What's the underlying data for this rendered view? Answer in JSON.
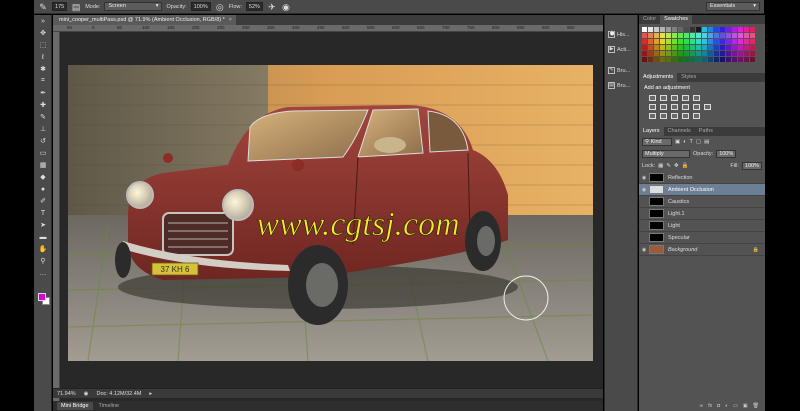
{
  "options_bar": {
    "brush_size": "175",
    "mode_label": "Mode:",
    "mode_value": "Screen",
    "opacity_label": "Opacity:",
    "opacity_value": "100%",
    "flow_label": "Flow:",
    "flow_value": "52%",
    "workspace": "Essentials"
  },
  "document": {
    "tab_title": "mini_cooper_multiPass.psd @ 71.9% (Ambient Occlusion, RGB/8) *",
    "ruler_ticks": [
      "50",
      "0",
      "50",
      "100",
      "150",
      "200",
      "250",
      "300",
      "350",
      "400",
      "450",
      "500",
      "550",
      "600",
      "650",
      "700",
      "750",
      "800",
      "850",
      "900",
      "950"
    ],
    "watermark": "www.cgtsj.com",
    "license_plate": "37 KH 6",
    "zoom": "71.94%",
    "doc_size": "Doc: 4.12M/32.4M"
  },
  "bottom_tabs": [
    "Mini Bridge",
    "Timeline"
  ],
  "mid_panel": [
    "His...",
    "Acti...",
    "Bru...",
    "Bru..."
  ],
  "panels": {
    "color_tabs": [
      "Color",
      "Swatches"
    ],
    "adjust_tabs": [
      "Adjustments",
      "Styles"
    ],
    "add_adjustment": "Add an adjustment",
    "layer_tabs": [
      "Layers",
      "Channels",
      "Paths"
    ],
    "kind_label": "Kind",
    "blend_mode": "Multiply",
    "opacity_label": "Opacity:",
    "opacity_value": "100%",
    "lock_label": "Lock:",
    "fill_label": "Fill:",
    "fill_value": "100%",
    "layers": [
      "Reflection",
      "Ambient Occlusion",
      "Caustics",
      "Light.1",
      "Light",
      "Specular",
      "Background"
    ]
  },
  "colors": {
    "foreground": "#d400d4",
    "background": "#ffffff",
    "selected_layer": "#6d7f95"
  }
}
